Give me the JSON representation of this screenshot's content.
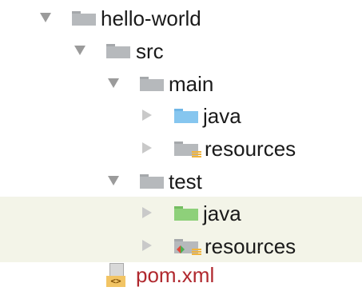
{
  "tree": {
    "root": {
      "label": "hello-world",
      "expanded": true
    },
    "src": {
      "label": "src",
      "expanded": true
    },
    "main": {
      "label": "main",
      "expanded": true
    },
    "main_java": {
      "label": "java",
      "expanded": false
    },
    "main_resources": {
      "label": "resources",
      "expanded": false
    },
    "test": {
      "label": "test",
      "expanded": true
    },
    "test_java": {
      "label": "java",
      "expanded": false
    },
    "test_resources": {
      "label": "resources",
      "expanded": false
    },
    "pom": {
      "label": "pom.xml",
      "icon_text": "<>"
    }
  },
  "colors": {
    "selected_row_bg": "#f3f4e8",
    "source_folder": "#86c6ef",
    "test_folder": "#8ed07a",
    "plain_folder": "#b6b9bc",
    "maven_file_text": "#b0282e",
    "resource_badge": "#f1b43c"
  }
}
